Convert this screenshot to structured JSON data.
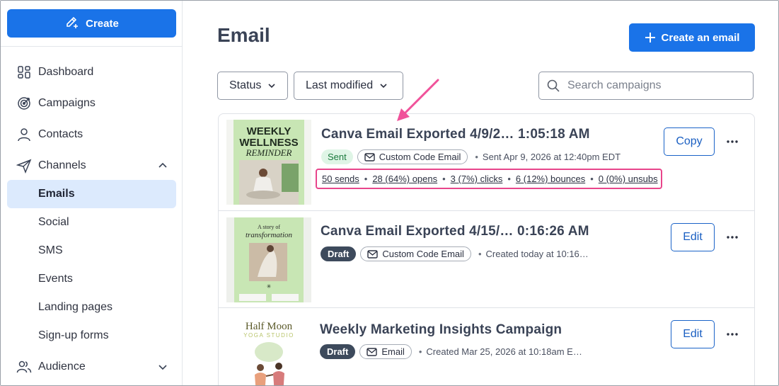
{
  "sidebar": {
    "create_label": "Create",
    "items": [
      {
        "label": "Dashboard",
        "icon": "dashboard-icon"
      },
      {
        "label": "Campaigns",
        "icon": "target-icon"
      },
      {
        "label": "Contacts",
        "icon": "person-icon"
      },
      {
        "label": "Channels",
        "icon": "send-icon"
      },
      {
        "label": "Emails"
      },
      {
        "label": "Social"
      },
      {
        "label": "SMS"
      },
      {
        "label": "Events"
      },
      {
        "label": "Landing pages"
      },
      {
        "label": "Sign-up forms"
      },
      {
        "label": "Audience",
        "icon": "people-icon"
      }
    ]
  },
  "header": {
    "title": "Email",
    "create_email_label": "Create an email"
  },
  "filters": {
    "status_label": "Status",
    "sort_label": "Last modified",
    "search_placeholder": "Search campaigns"
  },
  "campaigns": [
    {
      "title": "Canva Email Exported 4/9/2…  1:05:18 AM",
      "status": "Sent",
      "type": "Custom Code Email",
      "meta": "Sent Apr 9, 2026 at 12:40pm EDT",
      "action": "Copy",
      "thumb": {
        "line1": "WEEKLY",
        "line2": "WELLNESS",
        "line3": "REMINDER"
      },
      "stats": {
        "sends": "50 sends",
        "opens": "28 (64%) opens",
        "clicks": "3 (7%) clicks",
        "bounces": "6 (12%) bounces",
        "unsubs": "0 (0%) unsubs"
      }
    },
    {
      "title": "Canva Email Exported 4/15/…  0:16:26 AM",
      "status": "Draft",
      "type": "Custom Code Email",
      "meta": "Created today at 10:16…",
      "action": "Edit",
      "thumb": {
        "line1": "A story of",
        "line2": "transformation"
      }
    },
    {
      "title": "Weekly Marketing Insights Campaign",
      "status": "Draft",
      "type": "Email",
      "meta": "Created Mar 25, 2026 at 10:18am E…",
      "action": "Edit",
      "thumb": {
        "line1": "Half Moon",
        "line2": "YOGA STUDIO"
      }
    }
  ],
  "colors": {
    "primary": "#1a73e8",
    "active_nav": "#dceafd",
    "highlight": "#e8458b",
    "sent_badge": "#dff5e6",
    "draft_badge": "#3d4a5c"
  }
}
